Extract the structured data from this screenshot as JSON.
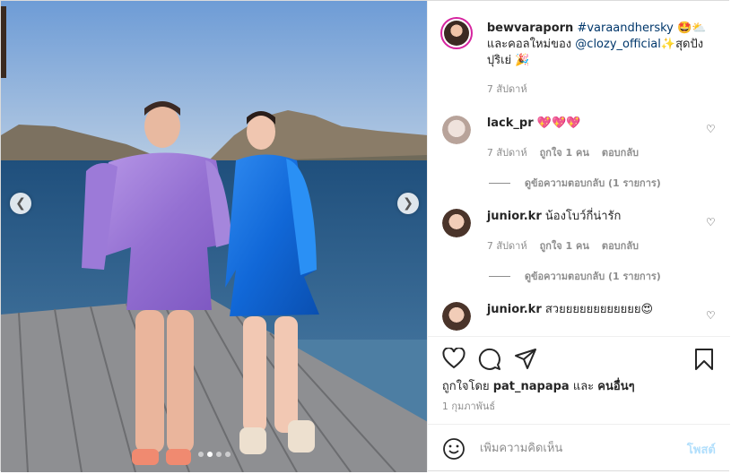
{
  "caption": {
    "username": "bewvaraporn",
    "hashtag": "#varaandhersky",
    "emoji1": "🤩⛅",
    "line2_prefix": "และคอลใหม่ของ ",
    "mention": "@clozy_official",
    "line2_suffix": "✨สุดปัง",
    "line3": "ปุริเย่ 🎉",
    "time": "7 สัปดาห์"
  },
  "comments": [
    {
      "username": "lack_pr",
      "text": "💖💖💖",
      "time": "7 สัปดาห์",
      "likes": "ถูกใจ 1 คน",
      "reply": "ตอบกลับ",
      "view_replies": "ดูข้อความตอบกลับ (1 รายการ)"
    },
    {
      "username": "junior.kr",
      "text": "น้องโบว์กี่น่ารัก",
      "time": "7 สัปดาห์",
      "likes": "ถูกใจ 1 คน",
      "reply": "ตอบกลับ",
      "view_replies": "ดูข้อความตอบกลับ (1 รายการ)"
    },
    {
      "username": "junior.kr",
      "text": "สวยยยยยยยยยยยย😍"
    }
  ],
  "likes_prefix": "ถูกใจโดย ",
  "likes_user": "pat_napapa",
  "likes_and": " และ ",
  "likes_others": "คนอื่นๆ",
  "post_date": "1 กุมภาพันธ์",
  "comment_placeholder": "เพิ่มความคิดเห็น",
  "post_button": "โพสต์",
  "icons": {
    "prev": "chevron-left-icon",
    "next": "chevron-right-icon",
    "like": "heart-icon",
    "comment": "comment-icon",
    "share": "paper-plane-icon",
    "save": "bookmark-icon",
    "emoji": "smiley-icon"
  },
  "carousel": {
    "slides": 4,
    "active": 2
  },
  "colors": {
    "link": "#00376b",
    "muted": "#8e8e8e",
    "post_button": "#b2dffc"
  }
}
